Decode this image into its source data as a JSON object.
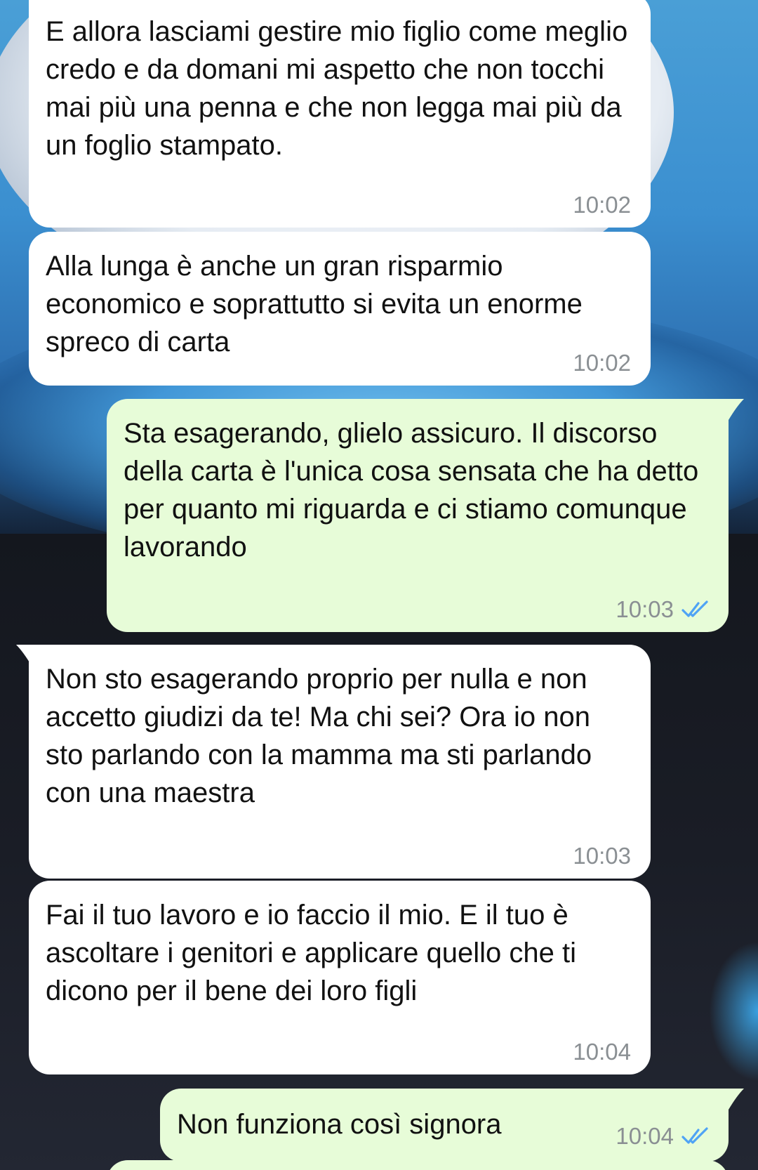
{
  "messages": [
    {
      "direction": "incoming",
      "text": "E allora lasciami gestire mio figlio come meglio credo e da domani mi aspetto che non tocchi mai più una penna e che non legga mai più da un foglio stampato.",
      "time": "10:02"
    },
    {
      "direction": "incoming",
      "text": "Alla lunga è anche un gran risparmio economico e soprattutto si evita un enorme spreco di carta",
      "time": "10:02"
    },
    {
      "direction": "outgoing",
      "text": "Sta esagerando, glielo assicuro. Il discorso della carta è l'unica cosa sensata che ha detto per quanto mi riguarda e ci stiamo comunque lavorando",
      "time": "10:03",
      "status": "read",
      "status_icon": "double-check-icon"
    },
    {
      "direction": "incoming",
      "text": "Non sto esagerando proprio per nulla e non accetto giudizi da te! Ma chi sei? Ora io non sto parlando con la mamma ma sti parlando con una maestra",
      "time": "10:03"
    },
    {
      "direction": "incoming",
      "text": "Fai il tuo lavoro e io faccio il mio. E il tuo è ascoltare i genitori e applicare quello che ti dicono per il bene dei loro figli",
      "time": "10:04"
    },
    {
      "direction": "outgoing",
      "text": "Non funziona così signora",
      "time": "10:04",
      "status": "read",
      "status_icon": "double-check-icon"
    }
  ],
  "colors": {
    "incoming_bubble": "#ffffff",
    "outgoing_bubble": "#e7fcd8",
    "timestamp": "#8a8f93",
    "read_ticks": "#4fa3f5"
  }
}
